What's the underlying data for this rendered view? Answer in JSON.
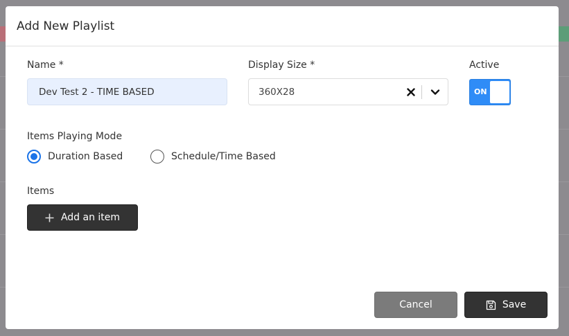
{
  "modal": {
    "title": "Add New Playlist"
  },
  "form": {
    "name": {
      "label": "Name *",
      "value": "Dev Test 2 - TIME BASED"
    },
    "display_size": {
      "label": "Display Size *",
      "value": "360X28",
      "clear_icon": "close-icon",
      "dropdown_icon": "chevron-down-icon"
    },
    "active": {
      "label": "Active",
      "state_text": "ON",
      "on": true,
      "color": "#2f8cf7"
    },
    "playing_mode": {
      "label": "Items Playing Mode",
      "options": [
        {
          "label": "Duration Based",
          "selected": true
        },
        {
          "label": "Schedule/Time Based",
          "selected": false
        }
      ],
      "accent": "#1a73e8"
    },
    "items": {
      "label": "Items",
      "add_button": "Add an item",
      "add_icon": "plus-icon"
    }
  },
  "footer": {
    "cancel": "Cancel",
    "save": "Save",
    "save_icon": "floppy-disk-icon"
  },
  "colors": {
    "dark_button": "#333333",
    "cancel_button": "#7b7b7b",
    "overlay": "#8d8b8f"
  }
}
